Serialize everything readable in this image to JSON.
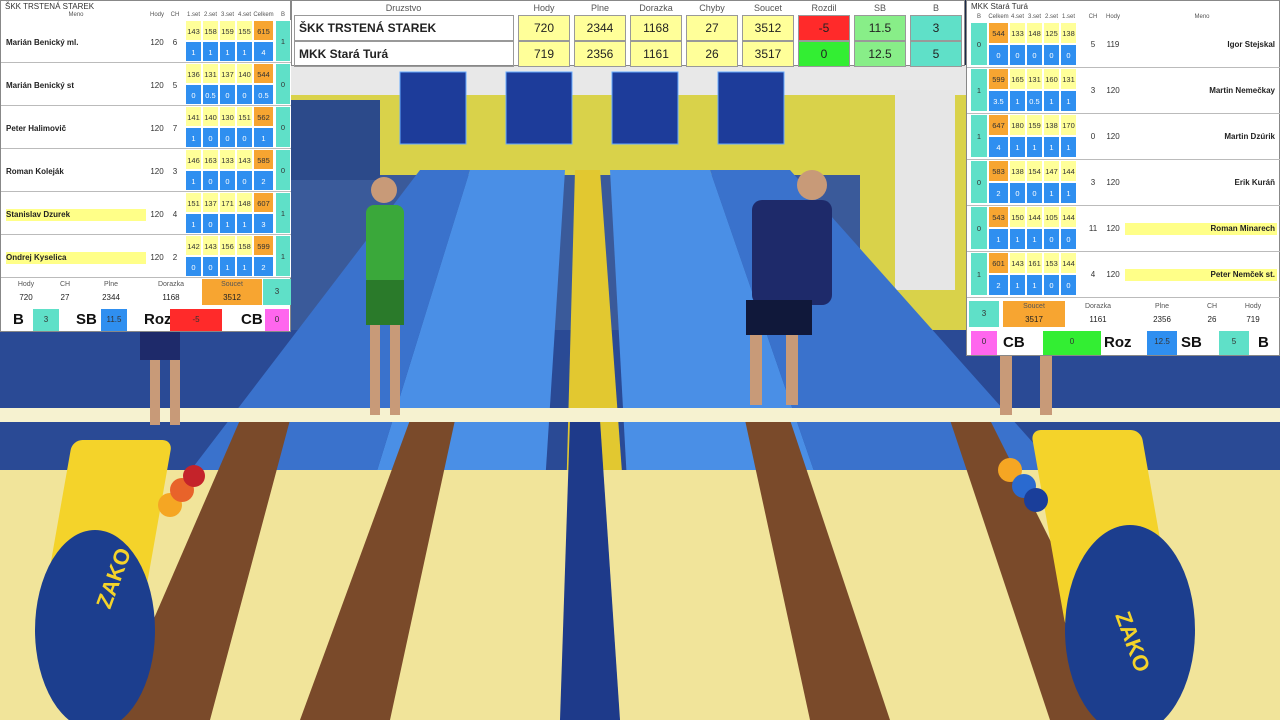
{
  "colors": {
    "yellow": "#ffff99",
    "blue": "#2f8ff0",
    "orange": "#f7a531",
    "turq": "#5fe0c8",
    "red": "#ff2a2a",
    "green": "#33ee33",
    "pink": "#ff66ee"
  },
  "scoreboard": {
    "headers": {
      "team": "Druzstvo",
      "hody": "Hody",
      "plne": "Plne",
      "dorazka": "Dorazka",
      "chyby": "Chyby",
      "soucet": "Soucet",
      "rozdil": "Rozdil",
      "sb": "SB",
      "b": "B"
    },
    "rows": [
      {
        "team": "ŠKK TRSTENÁ STAREK",
        "hody": "720",
        "plne": "2344",
        "dorazka": "1168",
        "chyby": "27",
        "soucet": "3512",
        "rozdil": "-5",
        "sb": "11.5",
        "b": "3"
      },
      {
        "team": "MKK Stará Turá",
        "hody": "719",
        "plne": "2356",
        "dorazka": "1161",
        "chyby": "26",
        "soucet": "3517",
        "rozdil": "0",
        "sb": "12.5",
        "b": "5"
      }
    ]
  },
  "left": {
    "title": "ŠKK TRSTENÁ STAREK",
    "headers": {
      "meno": "Meno",
      "hody": "Hody",
      "ch": "CH",
      "s1": "1.set",
      "s2": "2.set",
      "s3": "3.set",
      "s4": "4.set",
      "celkem": "Celkem",
      "b": "B"
    },
    "players": [
      {
        "name": "Marián Benický ml.",
        "hody": "120",
        "ch": "6",
        "sets": [
          "143",
          "158",
          "159",
          "155"
        ],
        "total": "615",
        "sb": [
          "1",
          "1",
          "1",
          "1"
        ],
        "sbtotal": "4",
        "b": "1",
        "hl": false
      },
      {
        "name": "Marián Benický st",
        "hody": "120",
        "ch": "5",
        "sets": [
          "136",
          "131",
          "137",
          "140"
        ],
        "total": "544",
        "sb": [
          "0",
          "0.5",
          "0",
          "0"
        ],
        "sbtotal": "0.5",
        "b": "0",
        "hl": false
      },
      {
        "name": "Peter Halimovič",
        "hody": "120",
        "ch": "7",
        "sets": [
          "141",
          "140",
          "130",
          "151"
        ],
        "total": "562",
        "sb": [
          "1",
          "0",
          "0",
          "0"
        ],
        "sbtotal": "1",
        "b": "0",
        "hl": false
      },
      {
        "name": "Roman Koleják",
        "hody": "120",
        "ch": "3",
        "sets": [
          "146",
          "163",
          "133",
          "143"
        ],
        "total": "585",
        "sb": [
          "1",
          "0",
          "0",
          "0"
        ],
        "sbtotal": "2",
        "b": "0",
        "hl": false
      },
      {
        "name": "Stanislav Dzurek",
        "hody": "120",
        "ch": "4",
        "sets": [
          "151",
          "137",
          "171",
          "148"
        ],
        "total": "607",
        "sb": [
          "1",
          "0",
          "1",
          "1"
        ],
        "sbtotal": "3",
        "b": "1",
        "hl": true
      },
      {
        "name": "Ondrej Kyselica",
        "hody": "120",
        "ch": "2",
        "sets": [
          "142",
          "143",
          "156",
          "158"
        ],
        "total": "599",
        "sb": [
          "0",
          "0",
          "1",
          "1"
        ],
        "sbtotal": "2",
        "b": "1",
        "hl": true
      }
    ],
    "summary": {
      "hody_l": "Hody",
      "hody": "720",
      "ch_l": "CH",
      "ch": "27",
      "plne_l": "Plne",
      "plne": "2344",
      "dor_l": "Dorazka",
      "dor": "1168",
      "sou_l": "Soucet",
      "sou": "3512",
      "b": "3"
    },
    "bottom": {
      "b_l": "B",
      "b": "3",
      "sb_l": "SB",
      "sb": "11.5",
      "roz_l": "Roz",
      "roz": "-5",
      "cb_l": "CB",
      "cb": "0"
    }
  },
  "right": {
    "title": "MKK Stará Turá",
    "headers": {
      "b": "B",
      "celkem": "Celkem",
      "s4": "4.set",
      "s3": "3.set",
      "s2": "2.set",
      "s1": "1.set",
      "ch": "CH",
      "hody": "Hody",
      "meno": "Meno"
    },
    "players": [
      {
        "name": "Igor Stejskal",
        "hody": "119",
        "ch": "5",
        "sets": [
          "133",
          "148",
          "125",
          "138"
        ],
        "total": "544",
        "sb": [
          "0",
          "0",
          "0",
          "0"
        ],
        "sbtotal": "0",
        "b": "0",
        "hl": false
      },
      {
        "name": "Martin Nemečkay",
        "hody": "120",
        "ch": "3",
        "sets": [
          "165",
          "131",
          "160",
          "131"
        ],
        "total": "599",
        "sb": [
          "1",
          "0.5",
          "1",
          "1"
        ],
        "sbtotal": "3.5",
        "b": "1",
        "hl": false
      },
      {
        "name": "Martin Dzúrik",
        "hody": "120",
        "ch": "0",
        "sets": [
          "180",
          "159",
          "138",
          "170"
        ],
        "total": "647",
        "sb": [
          "1",
          "1",
          "1",
          "1"
        ],
        "sbtotal": "4",
        "b": "1",
        "hl": false
      },
      {
        "name": "Erik Kuráň",
        "hody": "120",
        "ch": "3",
        "sets": [
          "138",
          "154",
          "147",
          "144"
        ],
        "total": "583",
        "sb": [
          "0",
          "0",
          "1",
          "1"
        ],
        "sbtotal": "2",
        "b": "0",
        "hl": false
      },
      {
        "name": "Roman Minarech",
        "hody": "120",
        "ch": "11",
        "sets": [
          "150",
          "144",
          "105",
          "144"
        ],
        "total": "543",
        "sb": [
          "1",
          "1",
          "0",
          "0"
        ],
        "sbtotal": "1",
        "b": "0",
        "hl": true
      },
      {
        "name": "Peter Nemček st.",
        "hody": "120",
        "ch": "4",
        "sets": [
          "143",
          "161",
          "153",
          "144"
        ],
        "total": "601",
        "sb": [
          "1",
          "1",
          "0",
          "0"
        ],
        "sbtotal": "2",
        "b": "1",
        "hl": true
      }
    ],
    "summary": {
      "b": "3",
      "sou_l": "Soucet",
      "sou": "3517",
      "dor_l": "Dorazka",
      "dor": "1161",
      "plne_l": "Plne",
      "plne": "2356",
      "ch_l": "CH",
      "ch": "26",
      "hody_l": "Hody",
      "hody": "719"
    },
    "bottom": {
      "cb": "0",
      "cb_l": "CB",
      "roz": "0",
      "roz_l": "Roz",
      "sb": "12.5",
      "sb_l": "SB",
      "b": "5",
      "b_l": "B"
    }
  },
  "scene": {
    "brand": "ZAKO",
    "board_text": "ŠKK TRSTENÁ STAREK",
    "board_text2": "MKK Stará Turá"
  }
}
